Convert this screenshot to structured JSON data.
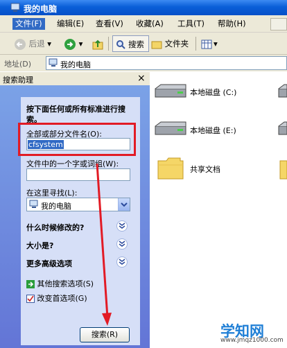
{
  "window": {
    "title": "我的电脑"
  },
  "menu": [
    "文件(F)",
    "编辑(E)",
    "查看(V)",
    "收藏(A)",
    "工具(T)",
    "帮助(H)"
  ],
  "toolbar": {
    "back": "后退",
    "search": "搜索",
    "folders": "文件夹"
  },
  "address": {
    "label": "地址(D)",
    "value": "我的电脑"
  },
  "search_panel": {
    "title": "搜索助理",
    "intro": "按下面任何或所有标准进行搜索。",
    "filename_label": "全部或部分文件名(O):",
    "filename_value": "cfsystem",
    "phrase_label": "文件中的一个字或词组(W):",
    "phrase_value": "",
    "lookin_label": "在这里寻找(L):",
    "lookin_value": "我的电脑",
    "sections": [
      "什么时候修改的?",
      "大小是?",
      "更多高级选项"
    ],
    "links": [
      "其他搜索选项(S)",
      "改变首选项(G)"
    ],
    "search_button": "搜索(R)"
  },
  "items": [
    {
      "label": "本地磁盘 (C:)",
      "icon": "drive-icon"
    },
    {
      "label": "本地磁盘 (E:)",
      "icon": "drive-icon"
    },
    {
      "label": "共享文档",
      "icon": "folder-icon"
    }
  ],
  "watermark": {
    "brand": "学知网",
    "url": "www.jmqz1000.com"
  },
  "colors": {
    "titlebar": "#0a5fd8",
    "panel": "#6f8ddf",
    "highlight": "#316ac5",
    "annotation": "#e21b25"
  }
}
